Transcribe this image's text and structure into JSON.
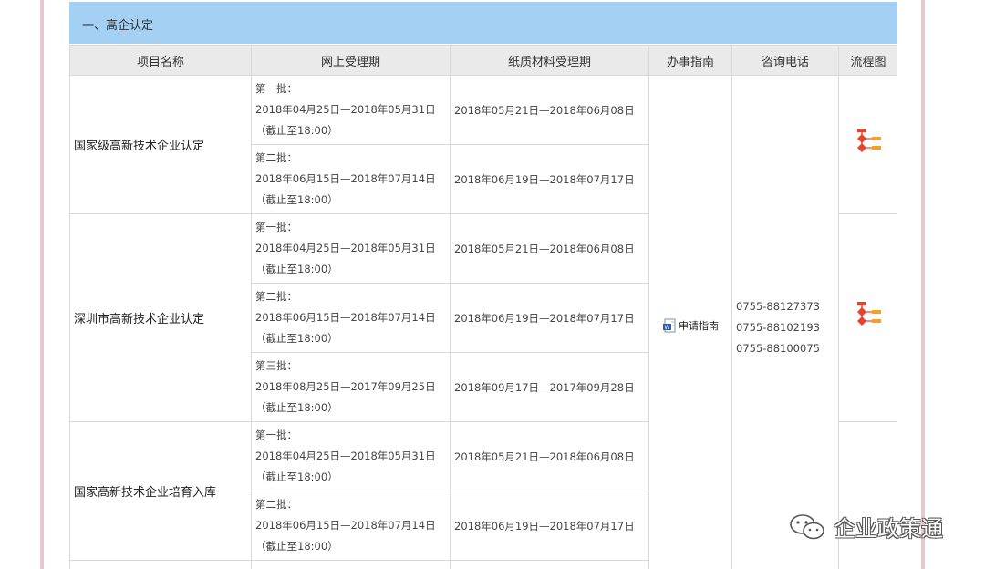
{
  "section": {
    "title": "一、高企认定"
  },
  "table": {
    "headers": [
      "项目名称",
      "网上受理期",
      "纸质材料受理期",
      "办事指南",
      "咨询电话",
      "流程图"
    ],
    "projects": [
      {
        "name": "国家级高新技术企业认定",
        "batches": [
          {
            "label": "第一批：",
            "online": "2018年04月25日—2018年05月31日",
            "deadline": "（截止至18:00）",
            "paper": "2018年05月21日—2018年06月08日"
          },
          {
            "label": "第二批：",
            "online": "2018年06月15日—2018年07月14日",
            "deadline": "（截止至18:00）",
            "paper": "2018年06月19日—2018年07月17日"
          }
        ]
      },
      {
        "name": "深圳市高新技术企业认定",
        "batches": [
          {
            "label": "第一批：",
            "online": "2018年04月25日—2018年05月31日",
            "deadline": "（截止至18:00）",
            "paper": "2018年05月21日—2018年06月08日"
          },
          {
            "label": "第二批：",
            "online": "2018年06月15日—2018年07月14日",
            "deadline": "（截止至18:00）",
            "paper": "2018年06月19日—2018年07月17日"
          },
          {
            "label": "第三批：",
            "online": "2018年08月25日—2017年09月25日",
            "deadline": "（截止至18:00）",
            "paper": "2018年09月17日—2017年09月28日"
          }
        ]
      },
      {
        "name": "国家高新技术企业培育入库",
        "batches": [
          {
            "label": "第一批：",
            "online": "2018年04月25日—2018年05月31日",
            "deadline": "（截止至18:00）",
            "paper": "2018年05月21日—2018年06月08日"
          },
          {
            "label": "第二批：",
            "online": "2018年06月15日—2018年07月14日",
            "deadline": "（截止至18:00）",
            "paper": "2018年06月19日—2018年07月17日"
          }
        ]
      }
    ],
    "guide_label": "申请指南",
    "phones": [
      "0755-88127373",
      "0755-88102193",
      "0755-88100075"
    ]
  },
  "watermark": {
    "text": "企业政策通"
  },
  "colors": {
    "header_bg": "#a3d0f3",
    "th_bg": "#eaeaea",
    "flow_red": "#e8432a",
    "flow_orange": "#f5a020"
  }
}
